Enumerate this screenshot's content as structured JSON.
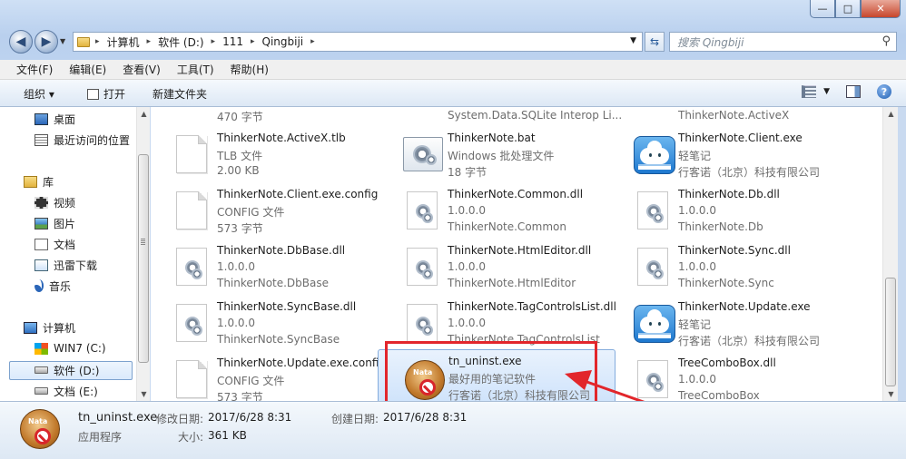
{
  "window": {
    "minimize_glyph": "—",
    "maximize_glyph": "□",
    "close_glyph": "✕"
  },
  "address": {
    "crumbs": [
      "计算机",
      "软件 (D:)",
      "111",
      "Qingbiji"
    ],
    "separator": "▸"
  },
  "search": {
    "placeholder": "搜索 Qingbiji"
  },
  "menu": {
    "items": [
      "文件(F)",
      "编辑(E)",
      "查看(V)",
      "工具(T)",
      "帮助(H)"
    ]
  },
  "toolbar": {
    "organize": "组织 ▾",
    "open": "打开",
    "new_folder": "新建文件夹"
  },
  "sidebar": {
    "items": [
      {
        "label": "桌面",
        "icon": "desktop-icon"
      },
      {
        "label": "最近访问的位置",
        "icon": "recent-places-icon"
      },
      {
        "label": "库",
        "icon": "library-icon"
      },
      {
        "label": "视频",
        "icon": "video-icon"
      },
      {
        "label": "图片",
        "icon": "picture-icon"
      },
      {
        "label": "文档",
        "icon": "document-icon"
      },
      {
        "label": "迅雷下载",
        "icon": "download-folder-icon"
      },
      {
        "label": "音乐",
        "icon": "music-icon"
      },
      {
        "label": "计算机",
        "icon": "computer-icon"
      },
      {
        "label": "WIN7 (C:)",
        "icon": "windows-drive-icon"
      },
      {
        "label": "软件 (D:)",
        "icon": "drive-icon"
      },
      {
        "label": "文档 (E:)",
        "icon": "drive-icon"
      }
    ]
  },
  "files": {
    "partial_row": [
      "470 字节",
      "System.Data.SQLite Interop Li...",
      "ThinkerNote.ActiveX"
    ],
    "tiles": [
      {
        "name": "ThinkerNote.ActiveX.tlb",
        "line2": "TLB 文件",
        "line3": "2.00 KB",
        "icon": "document-icon"
      },
      {
        "name": "ThinkerNote.bat",
        "line2": "Windows 批处理文件",
        "line3": "18 字节",
        "icon": "batch-file-icon"
      },
      {
        "name": "ThinkerNote.Client.exe",
        "line2": "轻笔记",
        "line3": "行客诺（北京）科技有限公司",
        "icon": "cloud-app-icon"
      },
      {
        "name": "ThinkerNote.Client.exe.config",
        "line2": "CONFIG 文件",
        "line3": "573 字节",
        "icon": "document-icon"
      },
      {
        "name": "ThinkerNote.Common.dll",
        "line2": "1.0.0.0",
        "line3": "ThinkerNote.Common",
        "icon": "dll-gear-icon"
      },
      {
        "name": "ThinkerNote.Db.dll",
        "line2": "1.0.0.0",
        "line3": "ThinkerNote.Db",
        "icon": "dll-gear-icon"
      },
      {
        "name": "ThinkerNote.DbBase.dll",
        "line2": "1.0.0.0",
        "line3": "ThinkerNote.DbBase",
        "icon": "dll-gear-icon"
      },
      {
        "name": "ThinkerNote.HtmlEditor.dll",
        "line2": "1.0.0.0",
        "line3": "ThinkerNote.HtmlEditor",
        "icon": "dll-gear-icon"
      },
      {
        "name": "ThinkerNote.Sync.dll",
        "line2": "1.0.0.0",
        "line3": "ThinkerNote.Sync",
        "icon": "dll-gear-icon"
      },
      {
        "name": "ThinkerNote.SyncBase.dll",
        "line2": "1.0.0.0",
        "line3": "ThinkerNote.SyncBase",
        "icon": "dll-gear-icon"
      },
      {
        "name": "ThinkerNote.TagControlsList.dll",
        "line2": "1.0.0.0",
        "line3": "ThinkerNote.TagControlsList",
        "icon": "dll-gear-icon"
      },
      {
        "name": "ThinkerNote.Update.exe",
        "line2": "轻笔记",
        "line3": "行客诺（北京）科技有限公司",
        "icon": "cloud-app-icon"
      },
      {
        "name": "ThinkerNote.Update.exe.config",
        "line2": "CONFIG 文件",
        "line3": "573 字节",
        "icon": "document-icon"
      },
      {
        "name": "tn_uninst.exe",
        "line2": "最好用的笔记软件",
        "line3": "行客诺（北京）科技有限公司",
        "icon": "nata-uninstall-icon",
        "selected": true
      },
      {
        "name": "TreeComboBox.dll",
        "line2": "1.0.0.0",
        "line3": "TreeComboBox",
        "icon": "dll-gear-icon"
      }
    ]
  },
  "status": {
    "name": "tn_uninst.exe",
    "type": "应用程序",
    "modified_label": "修改日期:",
    "modified_value": "2017/6/28 8:31",
    "created_label": "创建日期:",
    "created_value": "2017/6/28 8:31",
    "size_label": "大小:",
    "size_value": "361 KB"
  },
  "colors": {
    "highlight": "#e2262b",
    "selection": "#cfe3fb",
    "chrome": "#c9daf0"
  }
}
